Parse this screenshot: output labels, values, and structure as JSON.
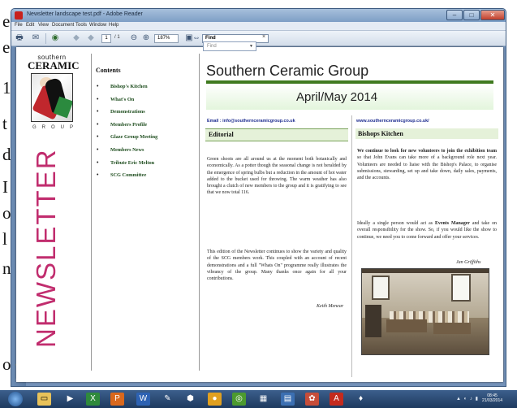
{
  "background_doc_chars": [
    "e",
    "e",
    "1",
    "t",
    "d",
    "I",
    "o",
    "l",
    "n",
    "o"
  ],
  "window": {
    "title": "Newsletter landscape test.pdf - Adobe Reader",
    "controls": {
      "minimize": "–",
      "maximize": "□",
      "close": "✕"
    }
  },
  "menubar": [
    "File",
    "Edit",
    "View",
    "Document",
    "Tools",
    "Window",
    "Help"
  ],
  "toolbar": {
    "page_current": "1",
    "page_total": "/ 1",
    "zoom": "187%",
    "find_value": "Find",
    "find_placeholder": "Find",
    "find_close": "×"
  },
  "newsletter": {
    "logo": {
      "top": "southern",
      "main": "CERAMIC",
      "bottom": "GROUP"
    },
    "vertical_title": "NEWSLETTER",
    "contents_title": "Contents",
    "contents": [
      "Bishop's Kitchen",
      "What's On",
      "Demonstrations",
      "Members Profile",
      "Glaze Group Meeting",
      "Members News",
      "Tribute Eric Melton",
      "SCG Committee"
    ],
    "header_title": "Southern Ceramic Group",
    "issue_date": "April/May  2014",
    "email_line": "Email : info@southernceramicgroup.co.uk",
    "web_line": "www.southernceramicgroup.co.uk/",
    "editorial": {
      "heading": "Editorial",
      "p1": "Green shoots are all around us at the moment both botanically and economically. As a potter though the seasonal change is not heralded by the emergence of spring bulbs but a reduction in the amount of hot water added to the bucket used for throwing. The warm weather has also brought a clutch of new members to the group and it is gratifying to see that we now total 116.",
      "p2": "This edition of the Newsletter continues to show the variety and quality of the SCG members work. This coupled with an account of recent demonstrations and a full \"Whats On\" programme really illustrates the vibrancy of the group. Many thanks once again for all your contributions.",
      "signature": "Keith Menear"
    },
    "bishops_kitchen": {
      "heading": "Bishops Kitchen",
      "p1_bold": "We continue to look for new volunteers to join the exhibition team",
      "p1_rest": " so that John Evans can take more of a background role next year. Volunteers are needed to liaise with the Bishop's Palace, to organise submissions, stewarding, set up and take down, daily sales, payments, and the accounts.",
      "p2_start": "Ideally a single person would act as ",
      "p2_bold": "Events Manager",
      "p2_rest": " and take on overall responsibility for the show. So, if you would like the show to continue, we need you to come forward and offer your services.",
      "signature": "Jan Griffiths"
    }
  },
  "taskbar": {
    "time": "08:45",
    "date": "21/03/2014"
  },
  "colors": {
    "accent_green": "#3f7a1e",
    "newsletter_magenta": "#c12d6e",
    "link_blue": "#1d2c8f",
    "window_blue": "#6f8fb6"
  }
}
